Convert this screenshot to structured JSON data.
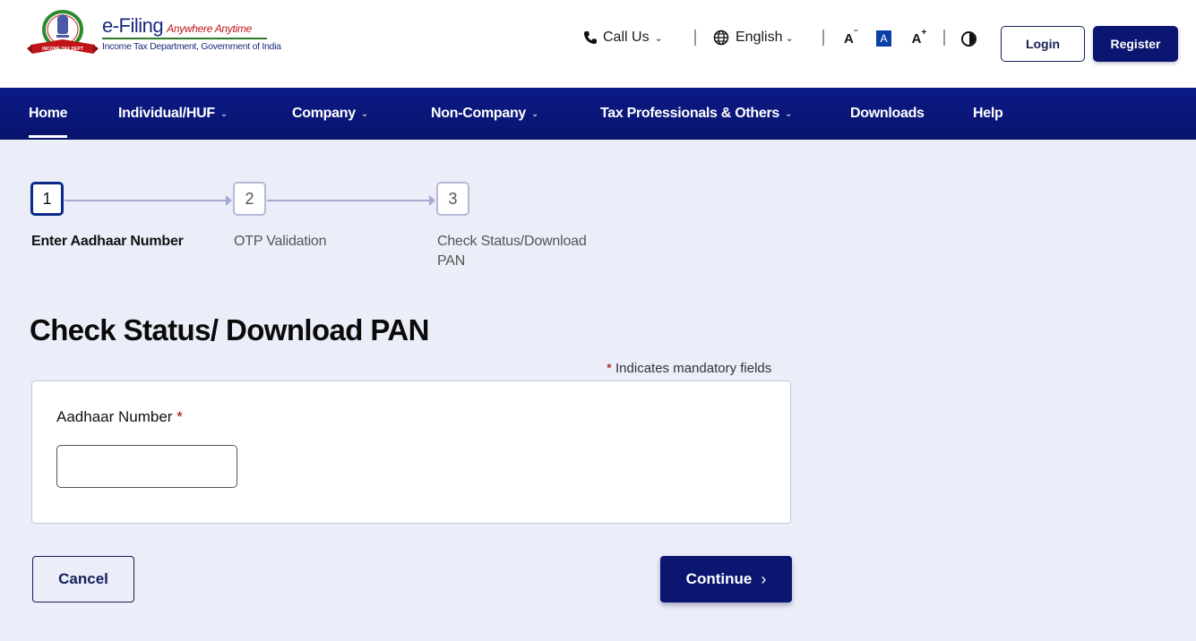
{
  "header": {
    "logo": {
      "title": "e-Filing",
      "tagline": "Anywhere Anytime",
      "department": "Income Tax Department, Government of India",
      "emblem_ribbon": "INCOME TAX DEPARTMENT"
    },
    "call_us": {
      "label": "Call Us",
      "icon": "phone-icon"
    },
    "language": {
      "label": "English",
      "icon": "globe-icon"
    },
    "font_controls": {
      "decrease": "A-",
      "normal": "A",
      "increase": "A+"
    },
    "contrast_icon": "contrast-icon",
    "login_label": "Login",
    "register_label": "Register"
  },
  "nav": {
    "items": [
      {
        "label": "Home",
        "active": true,
        "dropdown": false
      },
      {
        "label": "Individual/HUF",
        "dropdown": true
      },
      {
        "label": "Company",
        "dropdown": true
      },
      {
        "label": "Non-Company",
        "dropdown": true
      },
      {
        "label": "Tax Professionals & Others",
        "dropdown": true
      },
      {
        "label": "Downloads",
        "dropdown": false
      },
      {
        "label": "Help",
        "dropdown": false
      }
    ]
  },
  "stepper": {
    "current_step": 1,
    "steps": [
      {
        "number": "1",
        "label": "Enter Aadhaar Number"
      },
      {
        "number": "2",
        "label": "OTP Validation"
      },
      {
        "number": "3",
        "label": "Check Status/Download PAN"
      }
    ]
  },
  "main": {
    "title": "Check Status/ Download PAN",
    "mandatory_note_star": "*",
    "mandatory_note": "Indicates mandatory fields",
    "form": {
      "aadhaar_label": "Aadhaar Number",
      "aadhaar_required": "*",
      "aadhaar_value": "",
      "aadhaar_placeholder": ""
    },
    "cancel_label": "Cancel",
    "continue_label": "Continue"
  },
  "colors": {
    "brand_navy": "#0b1670",
    "nav_bg": "#0a1677",
    "page_bg": "#ebeef8",
    "required_red": "#a00000",
    "active_step_border": "#0a2a8a",
    "font_toggle_active": "#0a3fa8"
  }
}
